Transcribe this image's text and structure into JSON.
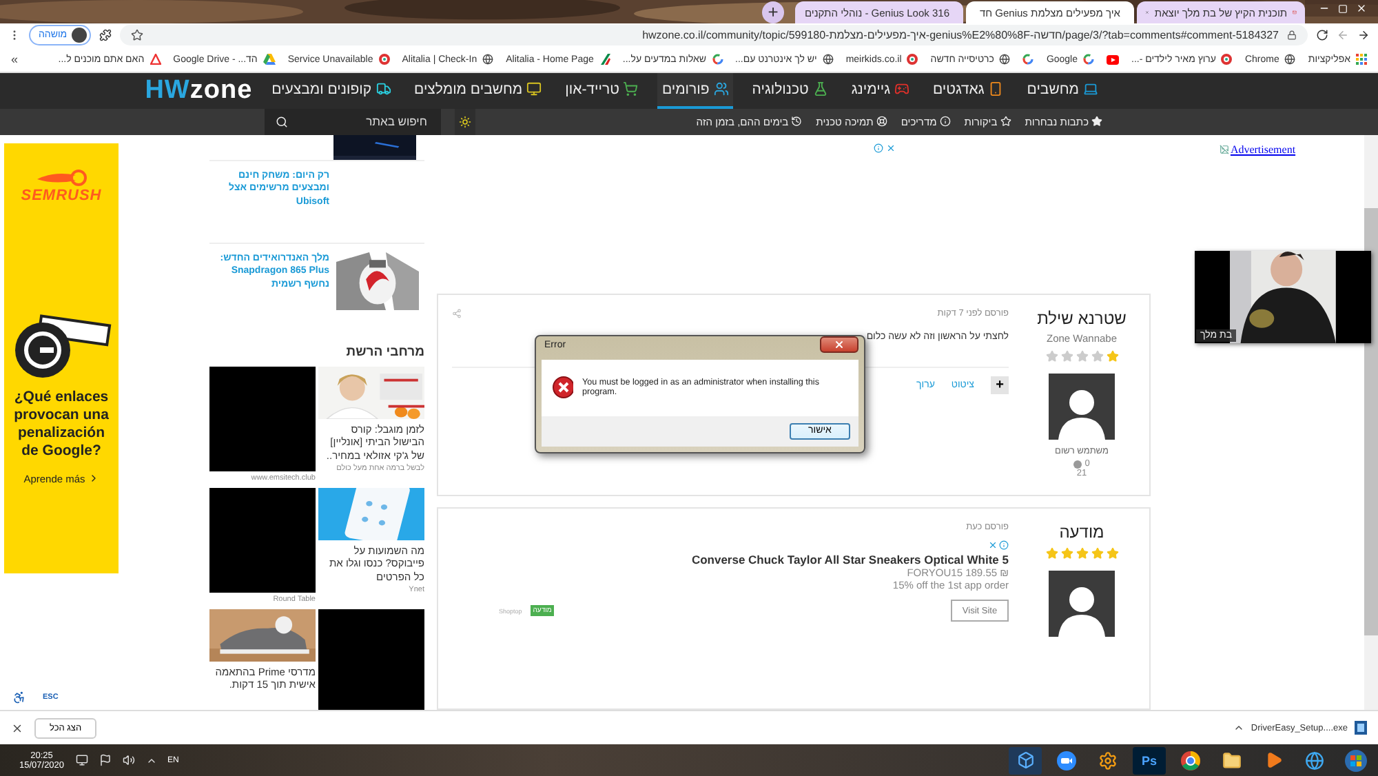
{
  "browser": {
    "tabs": [
      {
        "title": "תוכנית הקיץ של בת מלך יוצאת",
        "kind": "mail",
        "selected": false
      },
      {
        "title": "איך מפעילים מצלמת Genius חד",
        "kind": "site",
        "selected": true
      },
      {
        "title": "Genius Look 316 - נוהלי התקנים",
        "kind": "globe",
        "selected": false
      }
    ],
    "new_tab": "+",
    "url": "hwzone.co.il/community/topic/599180-איך-מפעילים-מצלמת-genius%E2%80%8F-חדשה/page/3/?tab=comments#comment-5184327",
    "profile": "מושהה",
    "bookmarks": [
      {
        "label": "אפליקציות",
        "kind": "apps"
      },
      {
        "label": "Chrome",
        "kind": "globe"
      },
      {
        "label": "ערוץ מאיר לילדים -...",
        "kind": "ring"
      },
      {
        "kind": "youtube"
      },
      {
        "label": "Google",
        "kind": "google"
      },
      {
        "kind": "google"
      },
      {
        "label": "כרטיסייה חדשה",
        "kind": "globe"
      },
      {
        "label": "meirkids.co.il",
        "kind": "ring"
      },
      {
        "label": "יש לך אינטרנט עם...",
        "kind": "globe"
      },
      {
        "label": "שאלות במדעים על...",
        "kind": "google"
      },
      {
        "label": "Alitalia - Home Page",
        "kind": "wing"
      },
      {
        "label": "Alitalia | Check-In",
        "kind": "globe"
      },
      {
        "label": "Service Unavailable",
        "kind": "ring"
      },
      {
        "label": "הד... - Google Drive",
        "kind": "drive"
      },
      {
        "label": "האם אתם מוכנים ל...",
        "kind": "redtri"
      }
    ],
    "more_bookmarks": "»"
  },
  "site": {
    "logo": {
      "prefix": "HW",
      "suffix": "zone"
    },
    "nav": [
      {
        "label": "מחשבים",
        "kind": "laptop",
        "selected": false
      },
      {
        "label": "גאדגטים",
        "kind": "phone",
        "selected": false
      },
      {
        "label": "גיימינג",
        "kind": "gamepad",
        "selected": false
      },
      {
        "label": "טכנולוגיה",
        "kind": "flask",
        "selected": false
      },
      {
        "label": "פורומים",
        "kind": "users",
        "selected": true
      },
      {
        "label": "טרייד-און",
        "kind": "cart",
        "selected": false
      },
      {
        "label": "מחשבים מומלצים",
        "kind": "monitor",
        "selected": false
      },
      {
        "label": "קופונים ומבצעים",
        "kind": "truck",
        "selected": false
      }
    ],
    "subnav": [
      {
        "label": "כתבות נבחרות",
        "kind": "star"
      },
      {
        "label": "ביקורות",
        "kind": "star-outline"
      },
      {
        "label": "מדריכים",
        "kind": "info"
      },
      {
        "label": "תמיכה טכנית",
        "kind": "lifebuoy"
      },
      {
        "label": "בימים ההם, בזמן הזה",
        "kind": "history"
      }
    ],
    "search": {
      "placeholder": "חיפוש באתר"
    }
  },
  "side_ad": {
    "brand": "SEMRUSH",
    "headline": "¿Qué enlaces provocan una penalización de Google?",
    "cta": "Aprende más"
  },
  "accessibility": {
    "esc": "ESC"
  },
  "sidebar": {
    "articles": [
      {
        "title": "רק היום: משחק חינם ומבצעים מרשימים אצל Ubisoft",
        "image": false
      },
      {
        "title": "מלך האנדרואידים החדש: Snapdragon 865 Plus נחשף רשמית",
        "image": true
      }
    ],
    "network": {
      "title": "מרחבי הרשת",
      "cards": [
        {
          "kind": "picture",
          "title": "לזמן מוגבל: קורס הבישול הביתי [אונליין] של ג'קי אזולאי במחיר..",
          "source": "לבשל ברמה אחת מעל כולם"
        },
        {
          "kind": "blank",
          "source": "www.emsitech.club"
        },
        {
          "kind": "picture",
          "title": "מה השמועות על פייבוקס? כנסו וגלו את כל הפרטים",
          "source": "Ynet"
        },
        {
          "kind": "blank",
          "source": "Round Table"
        },
        {
          "kind": "blank"
        },
        {
          "kind": "picture",
          "title": "מדרסי Prime בהתאמה אישית תוך 15 דקות."
        }
      ]
    }
  },
  "posts": [
    {
      "kind": "reply",
      "author": "שטרנא שילת",
      "rank": "Zone Wannabe",
      "stars": 1,
      "group": "משתמש רשום",
      "reputation": "0",
      "count": "21",
      "time": "פורסם לפני 7 דקות",
      "body": "לחצתי על הראשון וזה לא עשה כלום",
      "add": "+",
      "actions": [
        "ציטוט",
        "ערוך"
      ]
    },
    {
      "kind": "ad",
      "author": "מודעה",
      "stars": 5,
      "time": "פורסם כעת",
      "ad": {
        "title": "Converse Chuck Taylor All Star Sneakers Optical White 5",
        "price": "FORYOU15 189.55 ₪",
        "offer": "15% off the 1st app order",
        "button": "Visit Site",
        "tag": "מודעה",
        "advertiser": "Shoptop"
      }
    }
  ],
  "advertisement_link": "Advertisement",
  "video": {
    "name": "בת מלך"
  },
  "error_dialog": {
    "title": "Error",
    "message": "You must be logged in as an administrator when installing this program.",
    "button": "אישור"
  },
  "download_bar": {
    "file": "DriverEasy_Setup....exe",
    "show_all": "הצג הכל"
  },
  "taskbar": {
    "time": "20:25",
    "date": "15/07/2020",
    "language": "EN",
    "apps": [
      {
        "kind": "cube"
      },
      {
        "kind": "camera"
      },
      {
        "kind": "gear"
      },
      {
        "kind": "ps",
        "label": "Ps"
      },
      {
        "kind": "browser"
      },
      {
        "kind": "folder"
      },
      {
        "kind": "player"
      },
      {
        "kind": "ie"
      },
      {
        "kind": "start"
      }
    ]
  }
}
